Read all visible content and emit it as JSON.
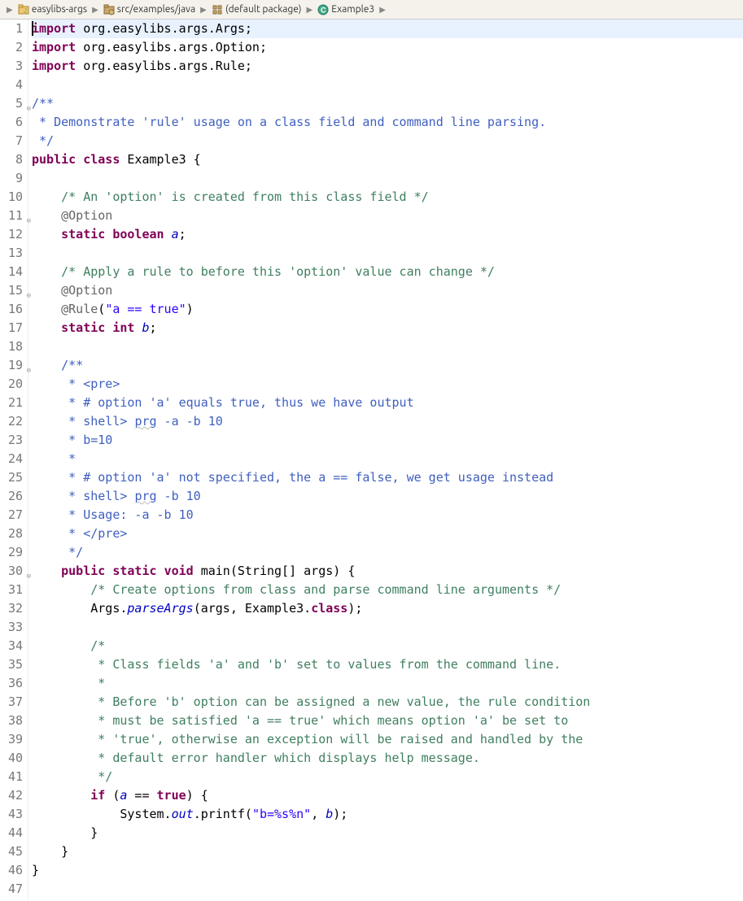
{
  "breadcrumb": {
    "items": [
      {
        "label": "easylibs-args",
        "icon": "project"
      },
      {
        "label": "src/examples/java",
        "icon": "source"
      },
      {
        "label": "(default package)",
        "icon": "package"
      },
      {
        "label": "Example3",
        "icon": "class"
      }
    ]
  },
  "code": {
    "l1": {
      "kw": "import",
      "rest": " org.easylibs.args.Args;"
    },
    "l2": {
      "kw": "import",
      "rest": " org.easylibs.args.Option;"
    },
    "l3": {
      "kw": "import",
      "rest": " org.easylibs.args.Rule;"
    },
    "l5": "/**",
    "l6": " * Demonstrate 'rule' usage on a class field and command line parsing.",
    "l7": " */",
    "l8": {
      "kw1": "public",
      "kw2": "class",
      "name": " Example3 {"
    },
    "l10": "    /* An 'option' is created from this class field */",
    "l11": "    @Option",
    "l12": {
      "kw1": "static",
      "kw2": "boolean",
      "f": "a",
      "rest": ";"
    },
    "l14": "    /* Apply a rule to before this 'option' value can change */",
    "l15": "    @Option",
    "l16": {
      "ann": "    @Rule",
      "paren": "(",
      "str": "\"a == true\"",
      "close": ")"
    },
    "l17": {
      "kw1": "static",
      "kw2": "int",
      "f": "b",
      "rest": ";"
    },
    "l19": "    /**",
    "l20": "     * <pre>",
    "l21": "     * # option 'a' equals true, thus we have output",
    "l22a": "     * shell> ",
    "l22b": "prg",
    "l22c": " -a -b 10",
    "l23": "     * b=10",
    "l24": "     * ",
    "l25": "     * # option 'a' not specified, the a == false, we get usage instead",
    "l26a": "     * shell> ",
    "l26b": "prg",
    "l26c": " -b 10",
    "l27": "     * Usage: -a -b 10",
    "l28": "     * </pre>",
    "l29": "     */",
    "l30": {
      "kw1": "public",
      "kw2": "static",
      "kw3": "void",
      "rest": " main(String[] args) {"
    },
    "l31": "        /* Create options from class and parse command line arguments */",
    "l32a": "        Args.",
    "l32b": "parseArgs",
    "l32c": "(args, Example3.",
    "l32d": "class",
    "l32e": ");",
    "l34": "        /*",
    "l35": "         * Class fields 'a' and 'b' set to values from the command line.",
    "l36": "         * ",
    "l37": "         * Before 'b' option can be assigned a new value, the rule condition",
    "l38": "         * must be satisfied 'a == true' which means option 'a' be set to",
    "l39": "         * 'true', otherwise an exception will be raised and handled by the",
    "l40": "         * default error handler which displays help message.",
    "l41": "         */",
    "l42a": "        ",
    "l42b": "if",
    "l42c": " (",
    "l42d": "a",
    "l42e": " == ",
    "l42f": "true",
    "l42g": ") {",
    "l43a": "            System.",
    "l43b": "out",
    "l43c": ".printf(",
    "l43d": "\"b=%s%n\"",
    "l43e": ", ",
    "l43f": "b",
    "l43g": ");",
    "l44": "        }",
    "l45": "    }",
    "l46": "}"
  }
}
